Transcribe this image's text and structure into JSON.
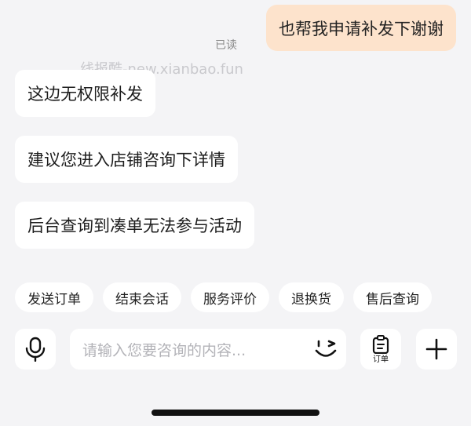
{
  "messages": {
    "outgoing": [
      {
        "text": "也帮我申请补发下谢谢"
      }
    ],
    "read_status": "已读",
    "incoming": [
      {
        "text": "这边无权限补发"
      },
      {
        "text": "建议您进入店铺咨询下详情"
      },
      {
        "text": "后台查询到凑单无法参与活动"
      }
    ]
  },
  "watermark": "线报酷-new.xianbao.fun",
  "quick_actions": [
    "发送订单",
    "结束会话",
    "服务评价",
    "退换货",
    "售后查询"
  ],
  "input_bar": {
    "placeholder": "请输入您要咨询的内容...",
    "order_label": "订单",
    "icons": [
      "microphone-icon",
      "wink-emoji-icon",
      "clipboard-order-icon",
      "plus-icon"
    ]
  },
  "colors": {
    "background": "#f4f4f6",
    "outgoing_bubble": "#fde3cc",
    "incoming_bubble": "#ffffff"
  }
}
